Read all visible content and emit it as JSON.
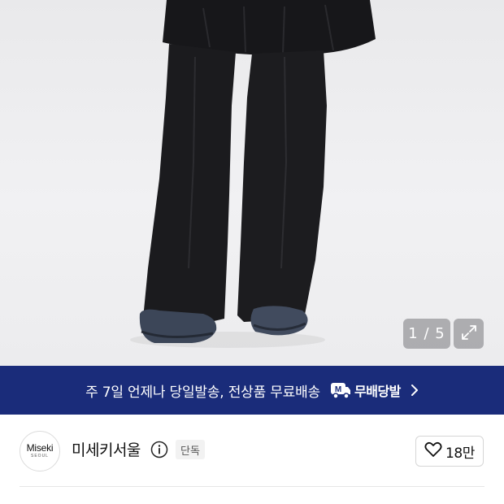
{
  "gallery": {
    "image_alt": "black wide-leg pants",
    "counter": "1 / 5"
  },
  "banner": {
    "text": "주 7일 언제나 당일발송, 전상품 무료배송",
    "badge_label": "무배당발",
    "badge_icon_letter": "M",
    "colors": {
      "background": "#1a2c7a",
      "text": "#ffffff"
    }
  },
  "store": {
    "logo_text": "Miseki",
    "logo_subtext": "SEOUL",
    "name": "미세키서울",
    "tag": "단독",
    "like_count": "18만"
  },
  "icons": [
    "expand-icon",
    "truck-icon",
    "chevron-right-icon",
    "info-icon",
    "heart-icon"
  ]
}
